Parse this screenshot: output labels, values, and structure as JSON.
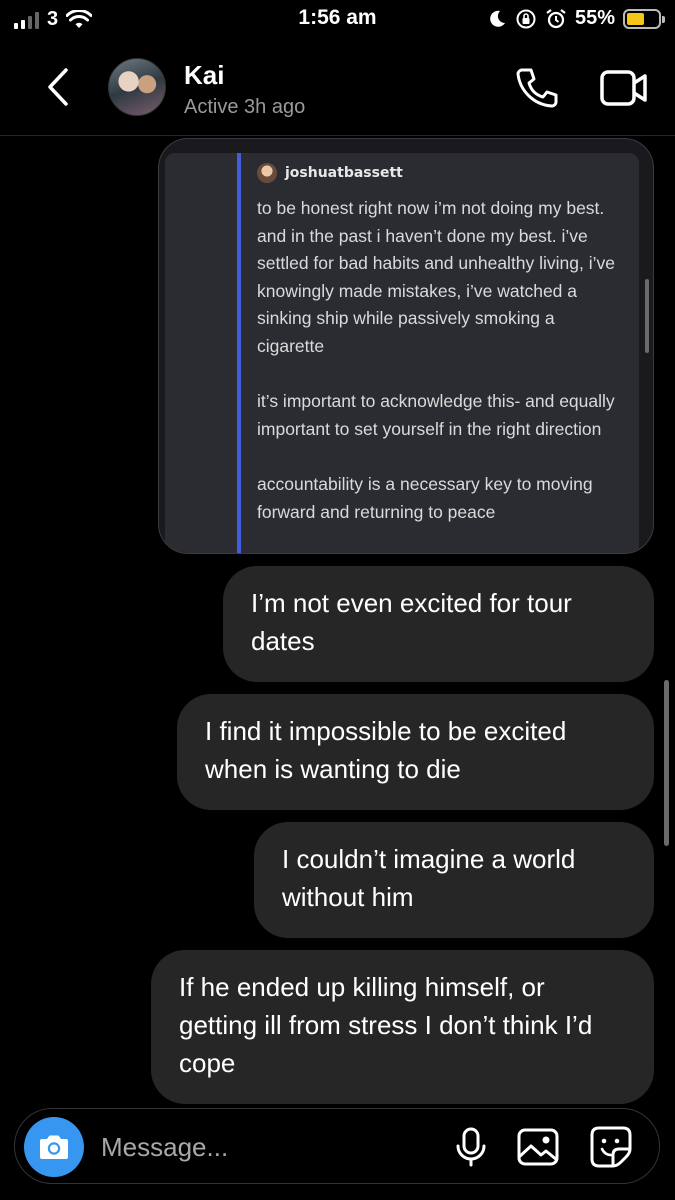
{
  "status_bar": {
    "carrier": "3",
    "time": "1:56 am",
    "battery": "55%",
    "battery_level": 0.55,
    "icons": [
      "signal-icon",
      "wifi-icon",
      "moon-icon",
      "rotation-lock-icon",
      "alarm-icon",
      "battery-icon"
    ]
  },
  "header": {
    "name": "Kai",
    "status": "Active 3h ago",
    "icons": [
      "back-chevron-icon",
      "phone-icon",
      "video-icon"
    ]
  },
  "shared_post": {
    "author": "joshuatbassett",
    "paragraphs": [
      "to be honest right now i’m not doing my best. and in the past i haven’t done my best. i’ve settled for bad habits and unhealthy living, i’ve knowingly made mistakes, i’ve watched a sinking ship while passively smoking a cigarette",
      "it’s important to acknowledge this- and equally important to set yourself in the right direction",
      "accountability is a necessary key to moving forward and returning to peace"
    ]
  },
  "messages": [
    {
      "text": "I’m not even excited for tour dates"
    },
    {
      "text": "I find it impossible to be excited when is wanting to die"
    },
    {
      "text": "I couldn’t imagine a world without him"
    },
    {
      "text": "If he ended up killing himself, or getting ill from stress I don’t think I’d cope"
    }
  ],
  "composer": {
    "placeholder": "Message...",
    "value": "",
    "icons": [
      "camera-icon",
      "microphone-icon",
      "gallery-icon",
      "sticker-icon"
    ]
  },
  "colors": {
    "background": "#000000",
    "bubble": "#262626",
    "accent_blue": "#3797f0",
    "quote_bar": "#3f5fe0",
    "battery_fill": "#f5c518"
  }
}
